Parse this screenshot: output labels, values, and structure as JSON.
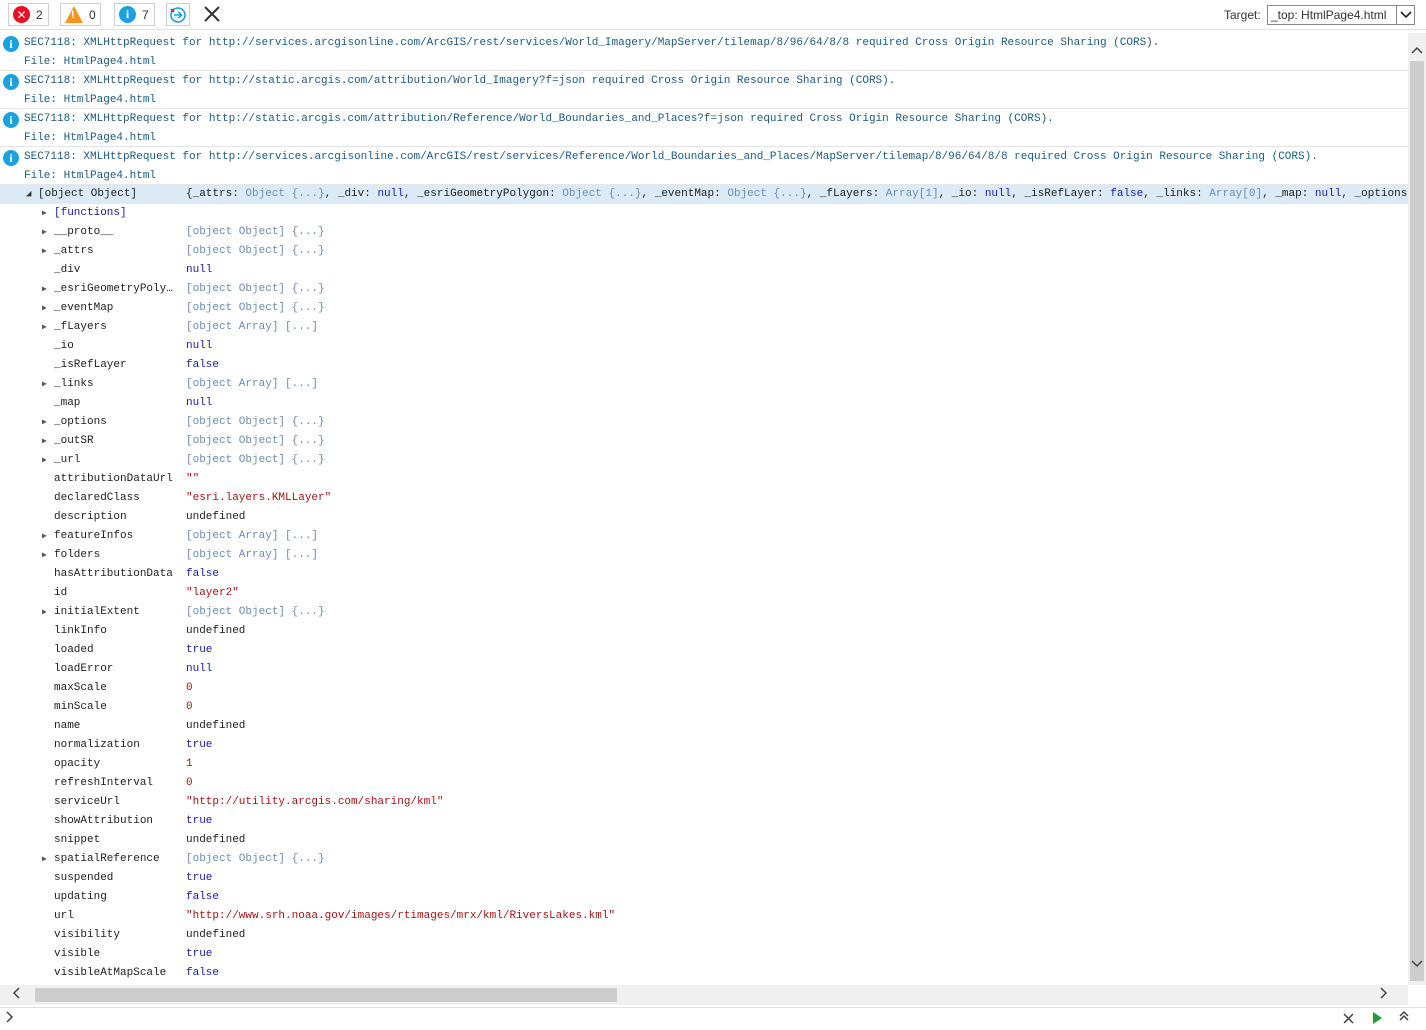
{
  "toolbar": {
    "errors_count": "2",
    "warnings_count": "0",
    "messages_count": "7",
    "target_label": "Target:",
    "target_value": "_top: HtmlPage4.html"
  },
  "messages": [
    {
      "text": "SEC7118: XMLHttpRequest for http://services.arcgisonline.com/ArcGIS/rest/services/World_Imagery/MapServer/tilemap/8/96/64/8/8 required Cross Origin Resource Sharing (CORS).",
      "file": "File: HtmlPage4.html"
    },
    {
      "text": "SEC7118: XMLHttpRequest for http://static.arcgis.com/attribution/World_Imagery?f=json required Cross Origin Resource Sharing (CORS).",
      "file": "File: HtmlPage4.html"
    },
    {
      "text": "SEC7118: XMLHttpRequest for http://static.arcgis.com/attribution/Reference/World_Boundaries_and_Places?f=json required Cross Origin Resource Sharing (CORS).",
      "file": "File: HtmlPage4.html"
    },
    {
      "text": "SEC7118: XMLHttpRequest for http://services.arcgisonline.com/ArcGIS/rest/services/Reference/World_Boundaries_and_Places/MapServer/tilemap/8/96/64/8/8 required Cross Origin Resource Sharing (CORS).",
      "file": "File: HtmlPage4.html"
    }
  ],
  "object": {
    "label": "[object Object]",
    "summary": "{_attrs: Object {...}, _div: null, _esriGeometryPolygon: Object {...}, _eventMap: Object {...}, _fLayers: Array[1], _io: null, _isRefLayer: false, _links: Array[0], _map: null, _options"
  },
  "properties": [
    {
      "name": "[functions]",
      "value": "",
      "expandable": true,
      "kind": "fn"
    },
    {
      "name": "__proto__",
      "value": "[object Object] {...}",
      "expandable": true,
      "kind": "obj"
    },
    {
      "name": "_attrs",
      "value": "[object Object] {...}",
      "expandable": true,
      "kind": "obj"
    },
    {
      "name": "_div",
      "value": "null",
      "expandable": false,
      "kind": "blue"
    },
    {
      "name": "_esriGeometryPoly…",
      "value": "[object Object] {...}",
      "expandable": true,
      "kind": "obj"
    },
    {
      "name": "_eventMap",
      "value": "[object Object] {...}",
      "expandable": true,
      "kind": "obj"
    },
    {
      "name": "_fLayers",
      "value": "[object Array] [...]",
      "expandable": true,
      "kind": "obj"
    },
    {
      "name": "_io",
      "value": "null",
      "expandable": false,
      "kind": "blue"
    },
    {
      "name": "_isRefLayer",
      "value": "false",
      "expandable": false,
      "kind": "blue"
    },
    {
      "name": "_links",
      "value": "[object Array] [...]",
      "expandable": true,
      "kind": "obj"
    },
    {
      "name": "_map",
      "value": "null",
      "expandable": false,
      "kind": "blue"
    },
    {
      "name": "_options",
      "value": "[object Object] {...}",
      "expandable": true,
      "kind": "obj"
    },
    {
      "name": "_outSR",
      "value": "[object Object] {...}",
      "expandable": true,
      "kind": "obj"
    },
    {
      "name": "_url",
      "value": "[object Object] {...}",
      "expandable": true,
      "kind": "obj"
    },
    {
      "name": "attributionDataUrl",
      "value": "\"\"",
      "expandable": false,
      "kind": "red"
    },
    {
      "name": "declaredClass",
      "value": "\"esri.layers.KMLLayer\"",
      "expandable": false,
      "kind": "red"
    },
    {
      "name": "description",
      "value": "undefined",
      "expandable": false,
      "kind": "undef"
    },
    {
      "name": "featureInfos",
      "value": "[object Array] [...]",
      "expandable": true,
      "kind": "obj"
    },
    {
      "name": "folders",
      "value": "[object Array] [...]",
      "expandable": true,
      "kind": "obj"
    },
    {
      "name": "hasAttributionData",
      "value": "false",
      "expandable": false,
      "kind": "blue"
    },
    {
      "name": "id",
      "value": "\"layer2\"",
      "expandable": false,
      "kind": "red"
    },
    {
      "name": "initialExtent",
      "value": "[object Object] {...}",
      "expandable": true,
      "kind": "obj"
    },
    {
      "name": "linkInfo",
      "value": "undefined",
      "expandable": false,
      "kind": "undef"
    },
    {
      "name": "loaded",
      "value": "true",
      "expandable": false,
      "kind": "blue"
    },
    {
      "name": "loadError",
      "value": "null",
      "expandable": false,
      "kind": "blue"
    },
    {
      "name": "maxScale",
      "value": "0",
      "expandable": false,
      "kind": "red"
    },
    {
      "name": "minScale",
      "value": "0",
      "expandable": false,
      "kind": "red"
    },
    {
      "name": "name",
      "value": "undefined",
      "expandable": false,
      "kind": "undef"
    },
    {
      "name": "normalization",
      "value": "true",
      "expandable": false,
      "kind": "blue"
    },
    {
      "name": "opacity",
      "value": "1",
      "expandable": false,
      "kind": "red"
    },
    {
      "name": "refreshInterval",
      "value": "0",
      "expandable": false,
      "kind": "red"
    },
    {
      "name": "serviceUrl",
      "value": "\"http://utility.arcgis.com/sharing/kml\"",
      "expandable": false,
      "kind": "red"
    },
    {
      "name": "showAttribution",
      "value": "true",
      "expandable": false,
      "kind": "blue"
    },
    {
      "name": "snippet",
      "value": "undefined",
      "expandable": false,
      "kind": "undef"
    },
    {
      "name": "spatialReference",
      "value": "[object Object] {...}",
      "expandable": true,
      "kind": "obj"
    },
    {
      "name": "suspended",
      "value": "true",
      "expandable": false,
      "kind": "blue"
    },
    {
      "name": "updating",
      "value": "false",
      "expandable": false,
      "kind": "blue"
    },
    {
      "name": "url",
      "value": "\"http://www.srh.noaa.gov/images/rtimages/mrx/kml/RiversLakes.kml\"",
      "expandable": false,
      "kind": "red"
    },
    {
      "name": "visibility",
      "value": "undefined",
      "expandable": false,
      "kind": "undef"
    },
    {
      "name": "visible",
      "value": "true",
      "expandable": false,
      "kind": "blue"
    },
    {
      "name": "visibleAtMapScale",
      "value": "false",
      "expandable": false,
      "kind": "blue"
    }
  ],
  "colors": {
    "error": "#e81123",
    "warning": "#f7941d",
    "info": "#1ba1e2",
    "selection": "#dceaf7",
    "keyword_blue": "#1a1aa6",
    "string_red": "#a31515"
  },
  "icons": {
    "errors": "error-icon",
    "warnings": "warning-icon",
    "messages": "info-icon",
    "clear_on_navigate": "clear-on-navigate-icon",
    "clear": "close-icon"
  }
}
